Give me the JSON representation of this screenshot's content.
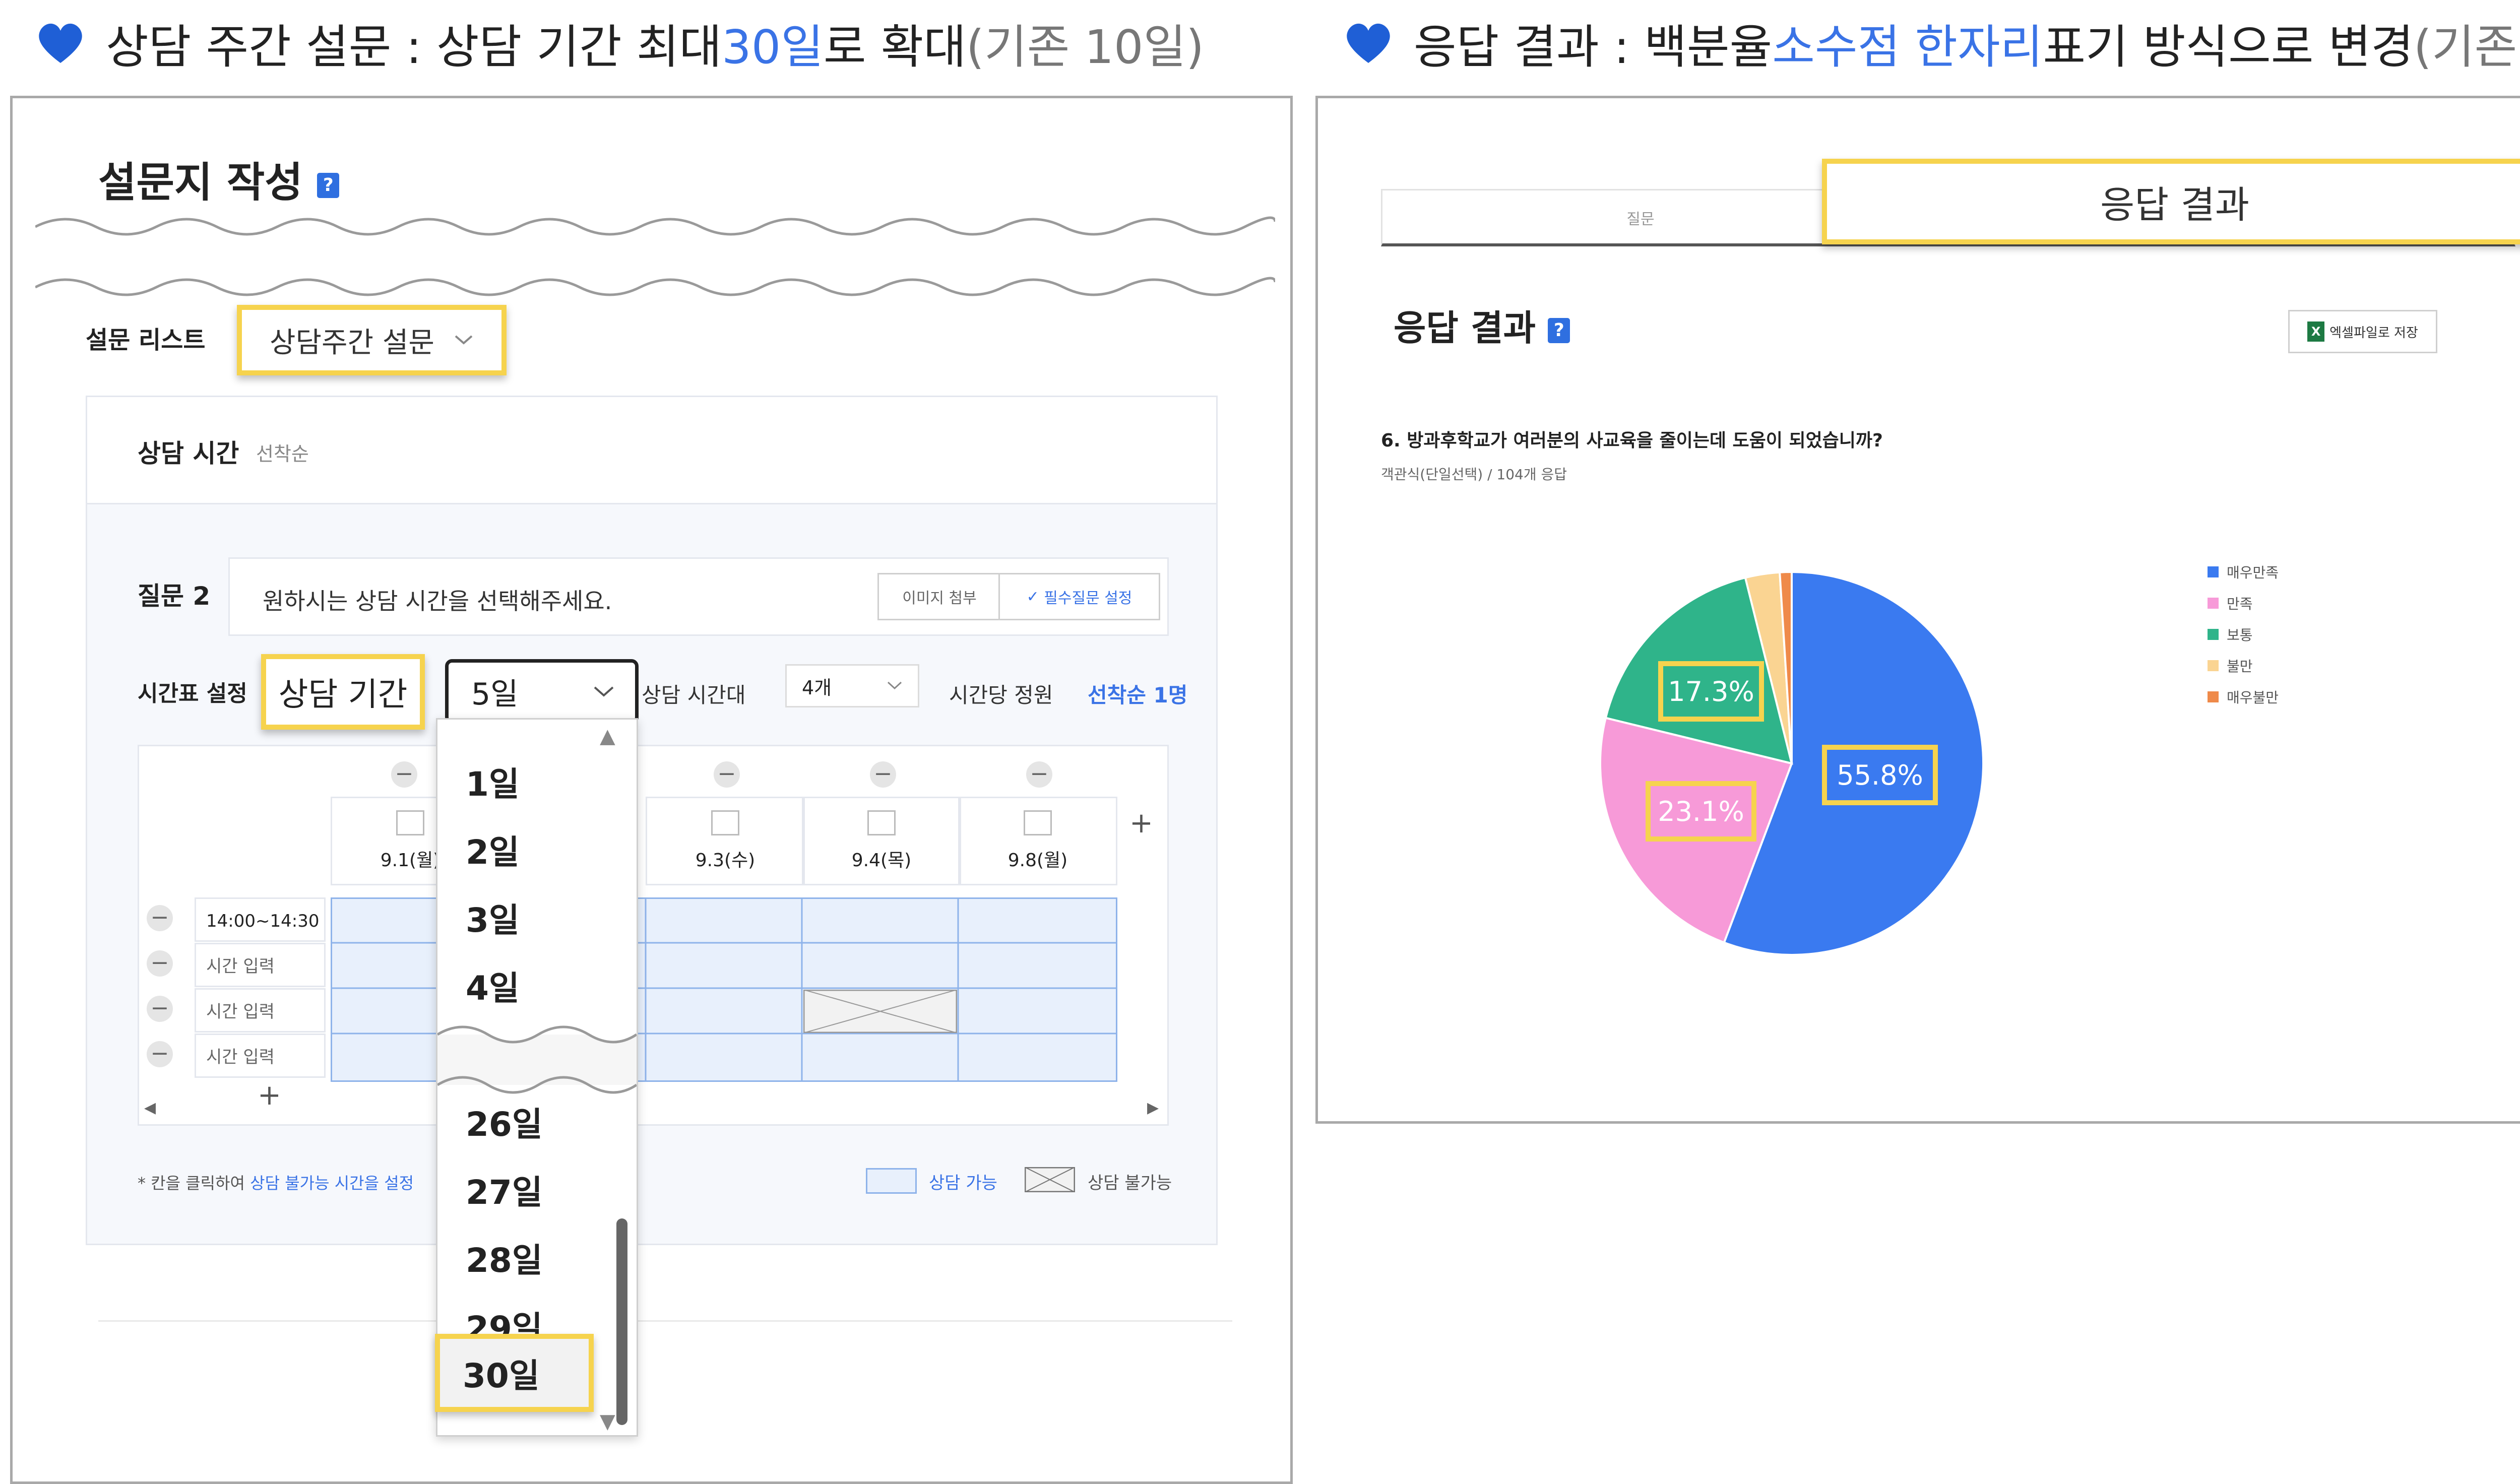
{
  "left_heading": {
    "pre": "상담 주간 설문 : 상담 기간 최대 ",
    "highlight": "30일",
    "post": "로 확대 ",
    "muted": "(기존 10일)"
  },
  "right_heading": {
    "pre": "응답 결과 : 백분율 ",
    "highlight": "소수점 한자리",
    "post": " 표기 방식으로 변경 ",
    "muted": "(기존 정수)"
  },
  "colors": {
    "accent": "#3a73e6",
    "highlight_border": "#f6d34e",
    "heart": "#1f5fd6"
  },
  "survey": {
    "title": "설문지 작성",
    "list_label": "설문 리스트",
    "list_value": "상담주간 설문",
    "section_title": "상담 시간",
    "section_sub": "선착순",
    "question_label": "질문 2",
    "question_text": "원하시는 상담 시간을 선택해주세요.",
    "attach_button": "이미지 첨부",
    "required_button": "필수질문 설정",
    "schedule_label": "시간표 설정",
    "period_label": "상담 기간",
    "period_value": "5일",
    "timeslot_label": "상담 시간대",
    "timeslot_value": "4개",
    "capacity_label": "시간당 정원",
    "capacity_value": "선착순 1명",
    "dates": [
      "9.1(월)",
      "9.3(수)",
      "9.4(목)",
      "9.8(월)"
    ],
    "times": [
      "14:00~14:30",
      "시간 입력",
      "시간 입력",
      "시간 입력"
    ],
    "footnote_pre": "* 칸을 클릭하여 ",
    "footnote_link": "상담 불가능 시간을 설정",
    "legend_available": "상담 가능",
    "legend_unavailable": "상담 불가능",
    "dropdown_options": [
      "1일",
      "2일",
      "3일",
      "4일",
      "26일",
      "27일",
      "28일",
      "29일",
      "30일"
    ],
    "dropdown_selected": "30일"
  },
  "results": {
    "tab_question": "질문",
    "tab_results": "응답 결과",
    "title": "응답 결과",
    "excel_button": "엑셀파일로 저장",
    "question": "6. 방과후학교가 여러분의 사교육을 줄이는데 도움이 되었습니까?",
    "question_meta": "객관식(단일선택) / 104개 응답"
  },
  "chart_data": {
    "type": "pie",
    "categories": [
      "매우만족",
      "만족",
      "보통",
      "불만",
      "매우불만"
    ],
    "values": [
      55.8,
      23.1,
      17.3,
      2.9,
      1.0
    ],
    "value_labels": [
      "55.8%",
      "23.1%",
      "17.3%"
    ],
    "colors": [
      "#3a7af0",
      "#f79ad8",
      "#2fb48a",
      "#fad492",
      "#ef8a4a"
    ],
    "legend_position": "right"
  }
}
